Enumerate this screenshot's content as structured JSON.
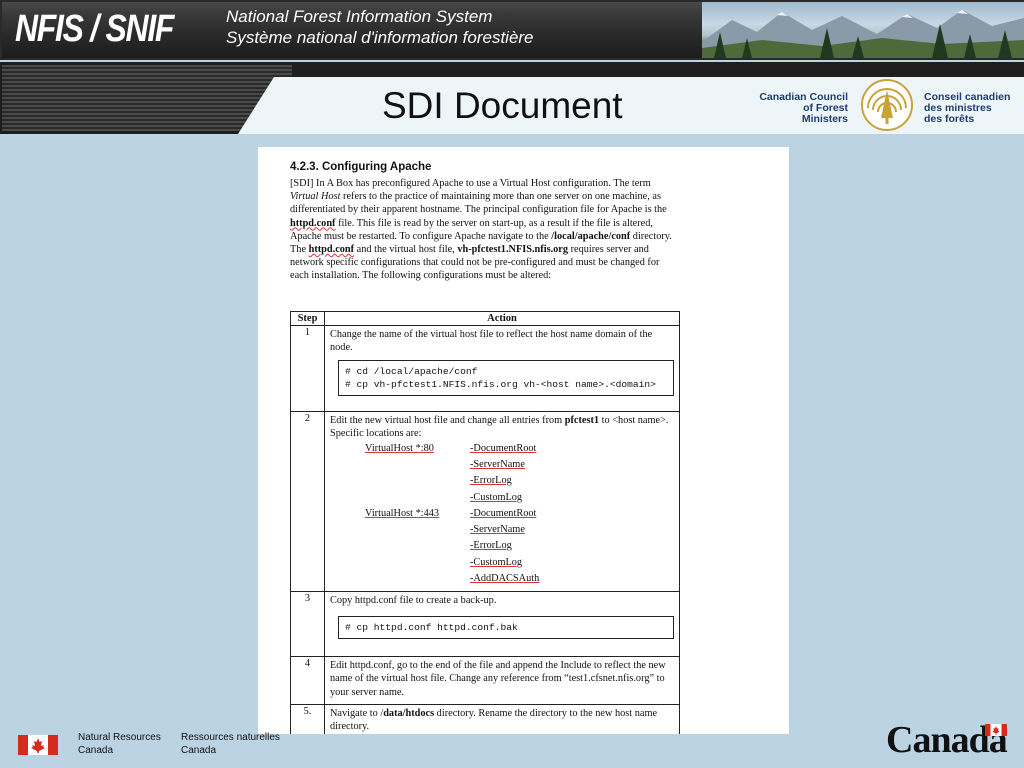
{
  "header": {
    "brand": "NFIS / SNIF",
    "system_en": "National Forest Information System",
    "system_fr": "Système national d'information forestière",
    "page_title": "SDI Document",
    "council_en": [
      "Canadian Council",
      "of Forest",
      "Ministers"
    ],
    "council_fr": [
      "Conseil canadien",
      "des ministres",
      "des forêts"
    ]
  },
  "document": {
    "heading": "4.2.3. Configuring Apache",
    "table_headers": {
      "step": "Step",
      "action": "Action"
    },
    "steps": [
      {
        "num": "1",
        "text": "Change the name of the virtual host file to reflect the host name domain of the node.",
        "code": [
          "# cd /local/apache/conf",
          "# cp vh-pfctest1.NFIS.nfis.org vh-<host name>.<domain>"
        ]
      },
      {
        "num": "2",
        "text_a": "Edit the new virtual host file and change all entries from ",
        "text_bold": "pfctest1",
        "text_b": " to <host name>.  Specific locations are:",
        "vhost80": "VirtualHost *:80",
        "vhost443": "VirtualHost *:443",
        "entries80": [
          "-DocumentRoot",
          "-ServerName",
          "-ErrorLog",
          "-CustomLog"
        ],
        "entries443": [
          "-DocumentRoot",
          "-ServerName",
          "-ErrorLog",
          "-CustomLog",
          "-AddDACSAuth"
        ]
      },
      {
        "num": "3",
        "text": "Copy httpd.conf file to create a back-up.",
        "code": [
          "# cp httpd.conf httpd.conf.bak"
        ]
      },
      {
        "num": "4",
        "text": "Edit httpd.conf, go to the end of the file and append the Include to reflect the new name of the virtual host file.  Change any reference from “test1.cfsnet.nfis.org” to your server name."
      },
      {
        "num": "5.",
        "text_a": "Navigate to /",
        "text_bold": "data/htdocs",
        "text_b": " directory.  Rename the directory to the new host name directory."
      }
    ]
  },
  "footer": {
    "dept_en": [
      "Natural Resources",
      "Canada"
    ],
    "dept_fr": [
      "Ressources naturelles",
      "Canada"
    ],
    "wordmark": "Canada"
  },
  "colors": {
    "background": "#bcd3e3",
    "header_dark": "#2a2a2a",
    "council_blue": "#1b3e6e",
    "flag_red": "#d52b1e"
  }
}
